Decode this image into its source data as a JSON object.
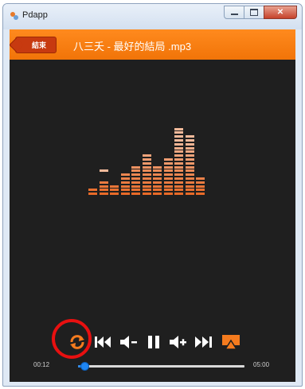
{
  "window": {
    "title": "Pdapp",
    "app_icon": "app-icon",
    "controls": [
      "minimize-icon",
      "maximize-icon",
      "close-icon"
    ]
  },
  "header": {
    "back_label": "結束",
    "track_title": "八三夭 - 最好的結局 .mp3"
  },
  "player": {
    "current_time": "00:12",
    "total_time": "05:00",
    "progress_fraction": 0.04,
    "controls": [
      {
        "name": "repeat-icon",
        "color": "#f57b1e"
      },
      {
        "name": "previous-icon",
        "color": "#ffffff"
      },
      {
        "name": "volume-down-icon",
        "color": "#ffffff"
      },
      {
        "name": "pause-icon",
        "color": "#ffffff"
      },
      {
        "name": "volume-up-icon",
        "color": "#ffffff"
      },
      {
        "name": "next-icon",
        "color": "#ffffff"
      },
      {
        "name": "airplay-icon",
        "color": "#f57b1e"
      }
    ],
    "highlighted_control": "repeat-icon"
  },
  "equalizer": {
    "bar_levels": [
      2,
      4,
      3,
      6,
      8,
      11,
      8,
      10,
      18,
      16,
      5
    ],
    "floating_peaks": [
      0,
      7,
      0,
      0,
      0,
      0,
      0,
      0,
      0,
      0,
      0
    ],
    "color_top": "#f2b99a",
    "color_bottom": "#e86a28"
  },
  "colors": {
    "accent": "#f57b1e",
    "background": "#1f1f1f",
    "highlight": "#e81010"
  }
}
